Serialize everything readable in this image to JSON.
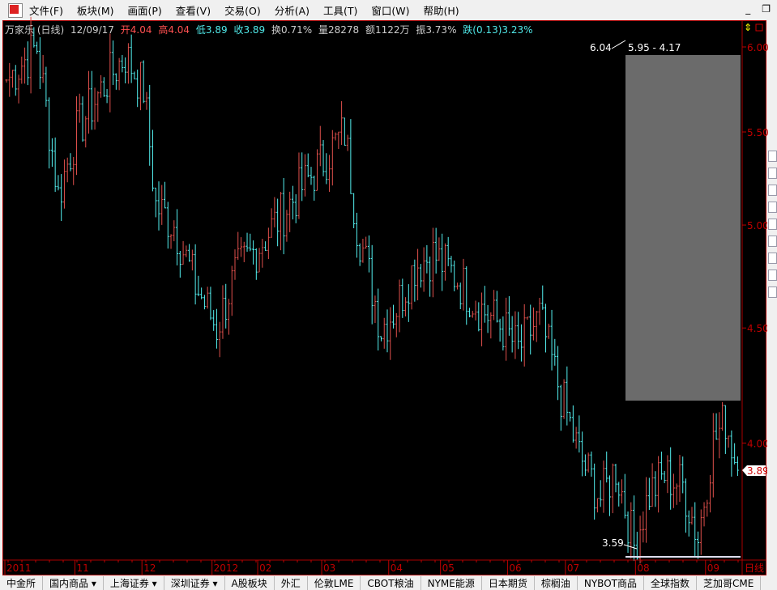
{
  "menu": [
    "文件(F)",
    "板块(M)",
    "画面(P)",
    "查看(V)",
    "交易(O)",
    "分析(A)",
    "工具(T)",
    "窗口(W)",
    "帮助(H)"
  ],
  "window_buttons": {
    "minimize": "_",
    "restore": "❐"
  },
  "info": {
    "name": "万家乐 (日线)",
    "date": "12/09/17",
    "open": "开4.04",
    "high": "高4.04",
    "low": "低3.89",
    "close": "收3.89",
    "turnover": "换0.71%",
    "volume": "量28278",
    "amount": "额1122万",
    "amplitude": "振3.73%",
    "change": "跌(0.13)3.23%"
  },
  "annotations": {
    "high": "6.04",
    "range": "5.95 - 4.17",
    "low": "3.59",
    "last_price": "3.89",
    "period": "日线"
  },
  "colors": {
    "up": "#e0504c",
    "down": "#54f0f0",
    "axis": "#c00000",
    "box": "#6b6b6b"
  },
  "tabs": [
    "中金所",
    "国内商品 ▾",
    "上海证券 ▾",
    "深圳证券 ▾",
    "A股板块",
    "外汇",
    "伦敦LME",
    "CBOT粮油",
    "NYME能源",
    "日本期货",
    "棕榈油",
    "NYBOT商品",
    "全球指数",
    "芝加哥CME"
  ],
  "chart_data": {
    "type": "candlestick",
    "title": "万家乐 (日线)",
    "y_ticks": [
      "6.00",
      "5.50",
      "5.00",
      "4.50",
      "4.00"
    ],
    "y_tick_values": [
      6.0,
      5.5,
      5.0,
      4.5,
      4.0
    ],
    "x_ticks": [
      {
        "label": "2011",
        "bar": 0
      },
      {
        "label": "11",
        "bar": 23
      },
      {
        "label": "12",
        "bar": 45
      },
      {
        "label": "2012",
        "bar": 68
      },
      {
        "label": "02",
        "bar": 83
      },
      {
        "label": "03",
        "bar": 104
      },
      {
        "label": "04",
        "bar": 126
      },
      {
        "label": "05",
        "bar": 143
      },
      {
        "label": "06",
        "bar": 165
      },
      {
        "label": "07",
        "bar": 184
      },
      {
        "label": "08",
        "bar": 207
      },
      {
        "label": "09",
        "bar": 230
      }
    ],
    "bars": 241,
    "close_keypoints": [
      [
        0,
        5.8
      ],
      [
        10,
        6.0
      ],
      [
        17,
        5.15
      ],
      [
        23,
        5.5
      ],
      [
        33,
        5.8
      ],
      [
        39,
        5.95
      ],
      [
        45,
        5.75
      ],
      [
        49,
        5.1
      ],
      [
        55,
        5.0
      ],
      [
        62,
        4.7
      ],
      [
        69,
        4.5
      ],
      [
        75,
        4.75
      ],
      [
        83,
        4.9
      ],
      [
        91,
        5.07
      ],
      [
        102,
        5.3
      ],
      [
        111,
        5.5
      ],
      [
        115,
        5.0
      ],
      [
        123,
        4.5
      ],
      [
        128,
        4.6
      ],
      [
        134,
        4.8
      ],
      [
        140,
        4.85
      ],
      [
        147,
        4.75
      ],
      [
        155,
        4.6
      ],
      [
        163,
        4.5
      ],
      [
        168,
        4.4
      ],
      [
        175,
        4.55
      ],
      [
        182,
        4.2
      ],
      [
        188,
        3.95
      ],
      [
        195,
        3.78
      ],
      [
        200,
        3.9
      ],
      [
        206,
        3.6
      ],
      [
        211,
        3.8
      ],
      [
        216,
        3.87
      ],
      [
        222,
        3.83
      ],
      [
        227,
        3.63
      ],
      [
        232,
        4.0
      ],
      [
        236,
        4.1
      ],
      [
        240,
        3.89
      ]
    ],
    "last_close": 3.89
  }
}
